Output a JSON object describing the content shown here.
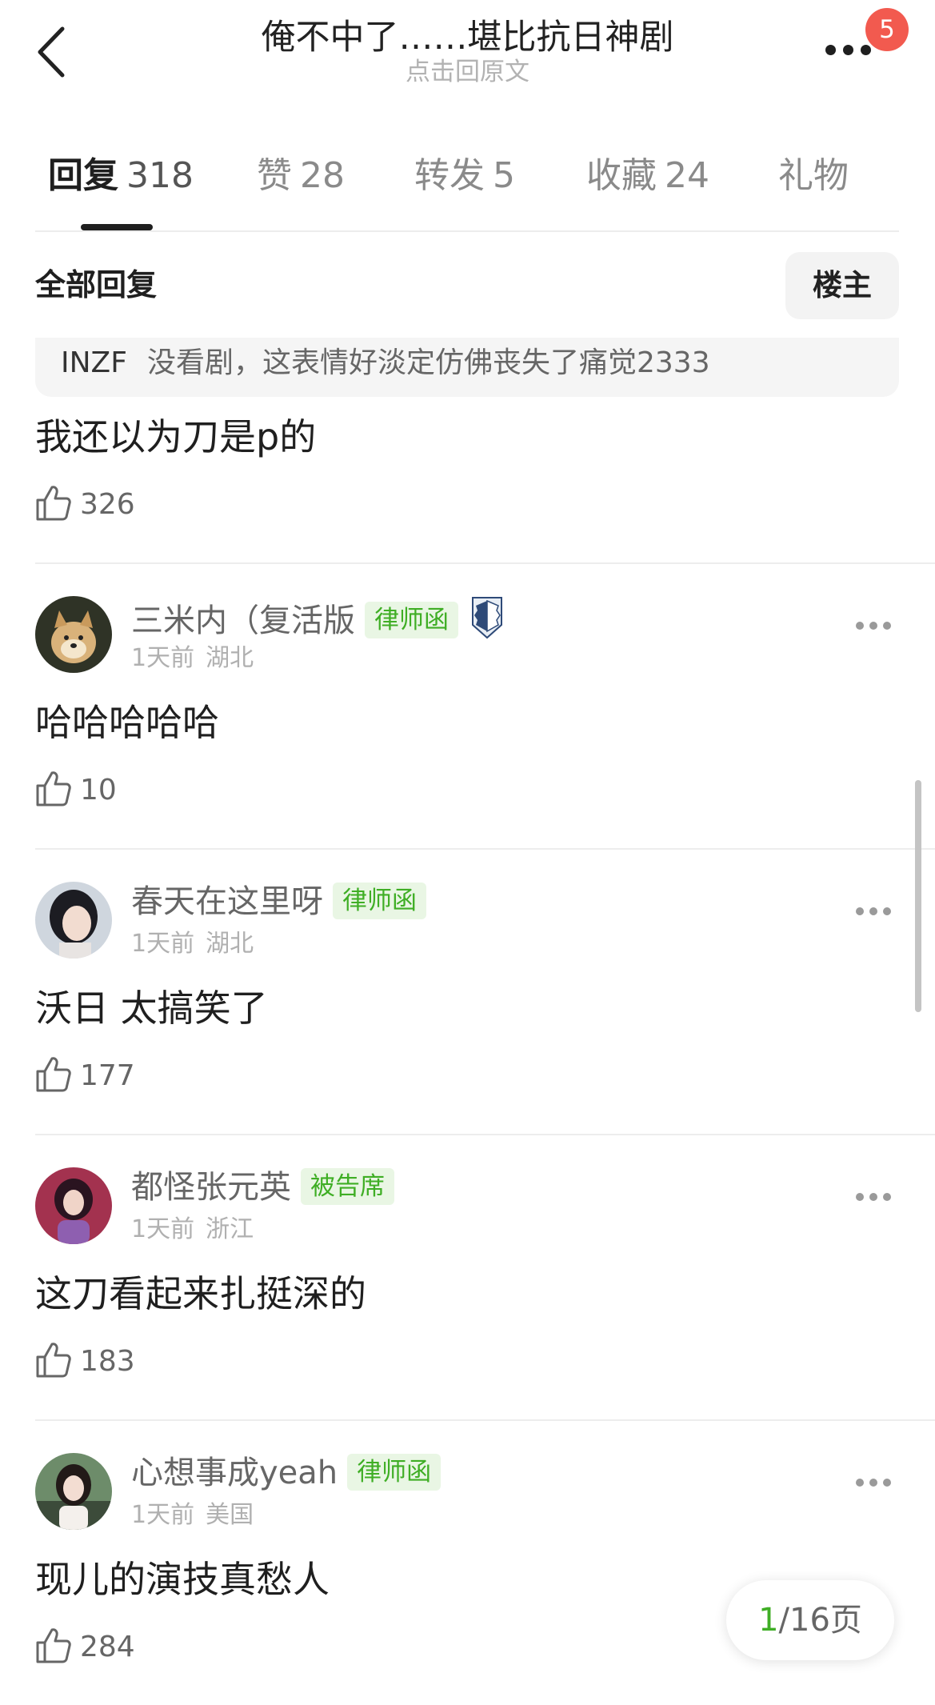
{
  "header": {
    "title": "俺不中了……堪比抗日神剧",
    "subtitle": "点击回原文",
    "notification_count": "5"
  },
  "tabs": [
    {
      "label": "回复",
      "count": "318",
      "active": true
    },
    {
      "label": "赞",
      "count": "28"
    },
    {
      "label": "转发",
      "count": "5"
    },
    {
      "label": "收藏",
      "count": "24"
    },
    {
      "label": "礼物",
      "count": ""
    }
  ],
  "filter": {
    "title": "全部回复",
    "owner_button": "楼主"
  },
  "first_comment": {
    "quote_user": "INZF",
    "quote_text": "没看剧，这表情好淡定仿佛丧失了痛觉2333",
    "text": "我还以为刀是p的",
    "likes": "326"
  },
  "comments": [
    {
      "username": "三米内（复活版",
      "tag": "律师函",
      "has_emblem": true,
      "time": "1天前",
      "location": "湖北",
      "text": "哈哈哈哈哈",
      "likes": "10"
    },
    {
      "username": "春天在这里呀",
      "tag": "律师函",
      "time": "1天前",
      "location": "湖北",
      "text": "沃日 太搞笑了",
      "likes": "177"
    },
    {
      "username": "都怪张元英",
      "tag": "被告席",
      "time": "1天前",
      "location": "浙江",
      "text": "这刀看起来扎挺深的",
      "likes": "183"
    },
    {
      "username": "心想事成yeah",
      "tag": "律师函",
      "time": "1天前",
      "location": "美国",
      "text": "现儿的演技真愁人",
      "likes": "284"
    }
  ],
  "pager": {
    "current": "1",
    "total": "/16页"
  },
  "colors": {
    "accent_green": "#3fae25",
    "badge_red": "#f25a4f",
    "tag_bg": "#e9f6e4"
  }
}
